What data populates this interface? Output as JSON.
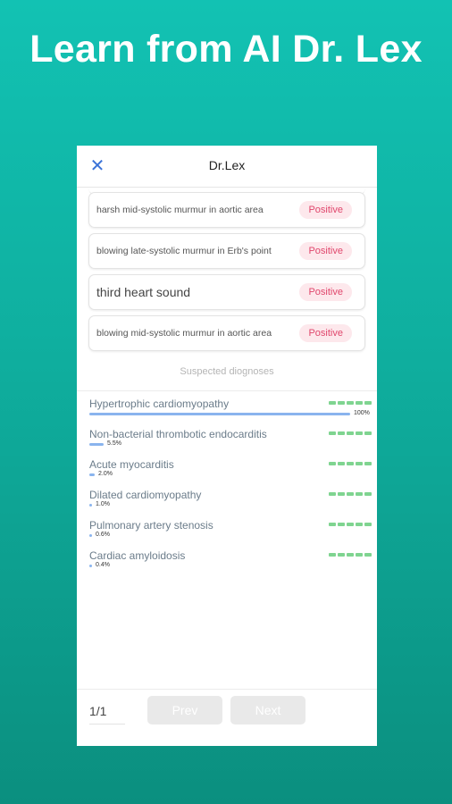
{
  "headline": "Learn from AI Dr. Lex",
  "app": {
    "title": "Dr.Lex",
    "close_icon": "close-x-icon"
  },
  "findings": [
    {
      "text": "harsh mid-systolic murmur in aortic area",
      "badge": "Positive"
    },
    {
      "text": "blowing late-systolic murmur in Erb's point",
      "badge": "Positive"
    },
    {
      "text": "third heart sound",
      "badge": "Positive"
    },
    {
      "text": "blowing mid-systolic murmur in aortic area",
      "badge": "Positive"
    }
  ],
  "suspected_label": "Suspected diognoses",
  "diagnoses": [
    {
      "name": "Hypertrophic cardiomyopathy",
      "percent_label": "100%",
      "fraction": 1.0
    },
    {
      "name": "Non-bacterial thrombotic endocarditis",
      "percent_label": "5.5%",
      "fraction": 0.055
    },
    {
      "name": "Acute myocarditis",
      "percent_label": "2.0%",
      "fraction": 0.02
    },
    {
      "name": "Dilated cardiomyopathy",
      "percent_label": "1.0%",
      "fraction": 0.01
    },
    {
      "name": "Pulmonary artery stenosis",
      "percent_label": "0.6%",
      "fraction": 0.006
    },
    {
      "name": "Cardiac amyloidosis",
      "percent_label": "0.4%",
      "fraction": 0.004
    }
  ],
  "pagination": {
    "page": "1/1",
    "prev_label": "Prev",
    "next_label": "Next"
  },
  "colors": {
    "background_top": "#12c2b3",
    "accent_blue": "#3b73d8",
    "positive_pink": "#e0466c",
    "level_green": "#7fd490"
  }
}
